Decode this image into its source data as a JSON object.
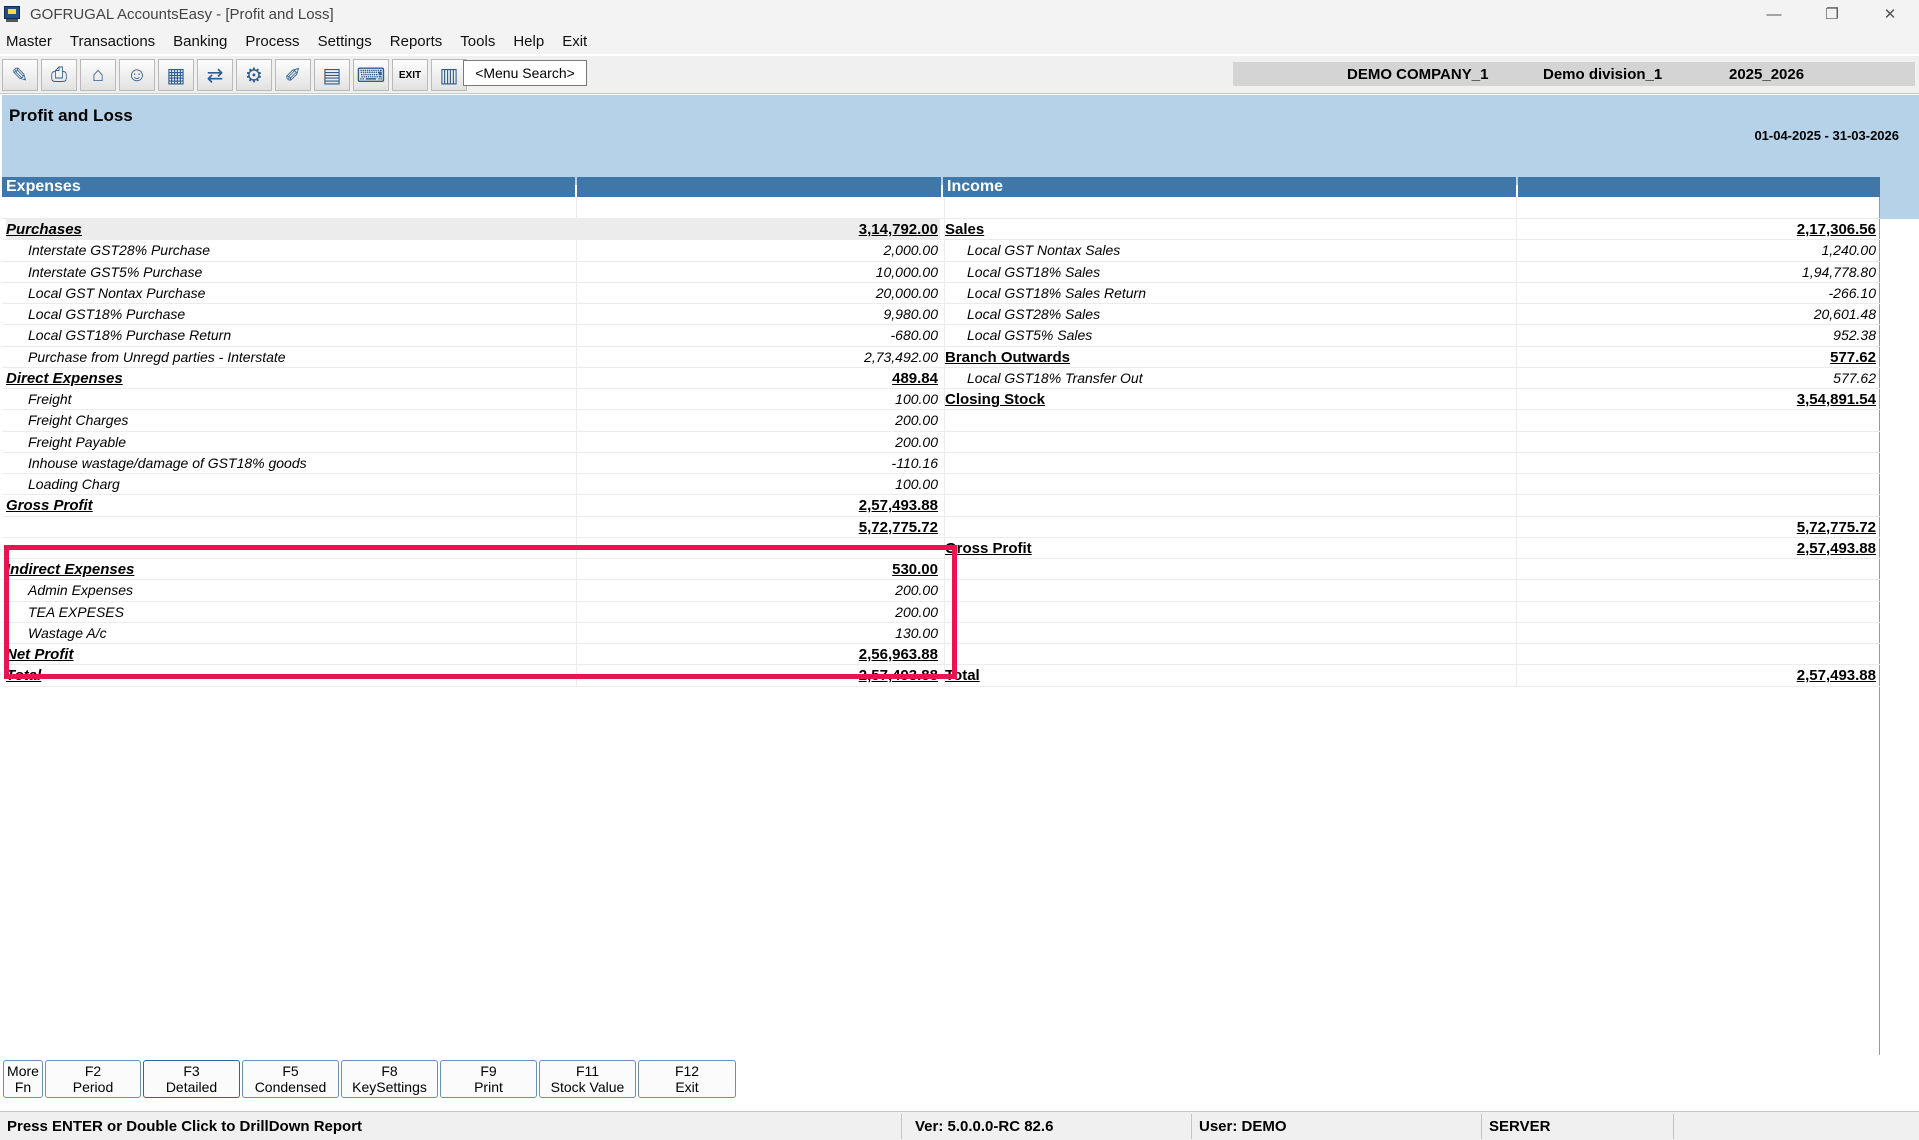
{
  "window": {
    "title": "GOFRUGAL AccountsEasy - [Profit and Loss]",
    "controls": {
      "minimize": "—",
      "restore": "❐",
      "close": "✕"
    }
  },
  "menu": [
    "Master",
    "Transactions",
    "Banking",
    "Process",
    "Settings",
    "Reports",
    "Tools",
    "Help",
    "Exit"
  ],
  "toolbar": {
    "icons": [
      "ledger-icon",
      "print-icon",
      "bank-icon",
      "users-icon",
      "inventory-icon",
      "transfer-icon",
      "network-icon",
      "edit-icon",
      "calendar-icon",
      "keyboard-icon",
      "exit-icon",
      "chart-icon"
    ],
    "exit_label": "EXIT",
    "menu_search": "<Menu Search>"
  },
  "company": {
    "name": "DEMO COMPANY_1",
    "division": "Demo division_1",
    "year": "2025_2026"
  },
  "report": {
    "title": "Profit and Loss",
    "period": "01-04-2025 - 31-03-2026",
    "headers": {
      "expenses": "Expenses",
      "income": "Income"
    },
    "rows": [
      {
        "le": "",
        "la": "",
        "re": "",
        "ra": ""
      },
      {
        "le": "Purchases",
        "la": "3,14,792.00",
        "re": "Sales",
        "ra": "2,17,306.56"
      },
      {
        "le": "Interstate GST28% Purchase",
        "la": "2,000.00",
        "re": "Local GST Nontax Sales",
        "ra": "1,240.00"
      },
      {
        "le": "Interstate GST5% Purchase",
        "la": "10,000.00",
        "re": "Local GST18% Sales",
        "ra": "1,94,778.80"
      },
      {
        "le": "Local GST Nontax Purchase",
        "la": "20,000.00",
        "re": "Local GST18% Sales Return",
        "ra": "-266.10"
      },
      {
        "le": "Local GST18% Purchase",
        "la": "9,980.00",
        "re": "Local GST28% Sales",
        "ra": "20,601.48"
      },
      {
        "le": "Local GST18% Purchase Return",
        "la": "-680.00",
        "re": "Local GST5% Sales",
        "ra": "952.38"
      },
      {
        "le": "Purchase from Unregd parties - Interstate",
        "la": "2,73,492.00",
        "re": "Branch Outwards",
        "ra": "577.62"
      },
      {
        "le": "Direct Expenses",
        "la": "489.84",
        "re": "Local GST18% Transfer Out",
        "ra": "577.62"
      },
      {
        "le": "Freight",
        "la": "100.00",
        "re": "Closing Stock",
        "ra": "3,54,891.54"
      },
      {
        "le": "Freight Charges",
        "la": "200.00",
        "re": "",
        "ra": ""
      },
      {
        "le": "Freight Payable",
        "la": "200.00",
        "re": "",
        "ra": ""
      },
      {
        "le": "Inhouse wastage/damage of GST18% goods",
        "la": "-110.16",
        "re": "",
        "ra": ""
      },
      {
        "le": "Loading Charg",
        "la": "100.00",
        "re": "",
        "ra": ""
      },
      {
        "le": "Gross Profit",
        "la": "2,57,493.88",
        "re": "",
        "ra": ""
      },
      {
        "le": "",
        "la": "5,72,775.72",
        "re": "",
        "ra": "5,72,775.72"
      },
      {
        "le": "",
        "la": "",
        "re": "Gross Profit",
        "ra": "2,57,493.88"
      },
      {
        "le": "Indirect Expenses",
        "la": "530.00",
        "re": "",
        "ra": ""
      },
      {
        "le": "Admin Expenses",
        "la": "200.00",
        "re": "",
        "ra": ""
      },
      {
        "le": "TEA EXPESES",
        "la": "200.00",
        "re": "",
        "ra": ""
      },
      {
        "le": "Wastage A/c",
        "la": "130.00",
        "re": "",
        "ra": ""
      },
      {
        "le": "Net Profit",
        "la": "2,56,963.88",
        "re": "",
        "ra": ""
      },
      {
        "le": "Total",
        "la": "2,57,493.88",
        "re": "Total",
        "ra": "2,57,493.88"
      }
    ]
  },
  "function_keys": [
    {
      "key": "More",
      "label": "Fn"
    },
    {
      "key": "F2",
      "label": "Period"
    },
    {
      "key": "F3",
      "label": "Detailed"
    },
    {
      "key": "F5",
      "label": "Condensed"
    },
    {
      "key": "F8",
      "label": "KeySettings"
    },
    {
      "key": "F9",
      "label": "Print"
    },
    {
      "key": "F11",
      "label": "Stock Value"
    },
    {
      "key": "F12",
      "label": "Exit"
    }
  ],
  "status": {
    "hint": "Press ENTER or Double Click to DrillDown Report",
    "version": "Ver: 5.0.0.0-RC 82.6",
    "user": "User: DEMO",
    "server": "SERVER"
  },
  "colors": {
    "header_blue": "#3f77a8",
    "panel_blue": "#b5d2e9",
    "highlight": "#e8134f"
  }
}
